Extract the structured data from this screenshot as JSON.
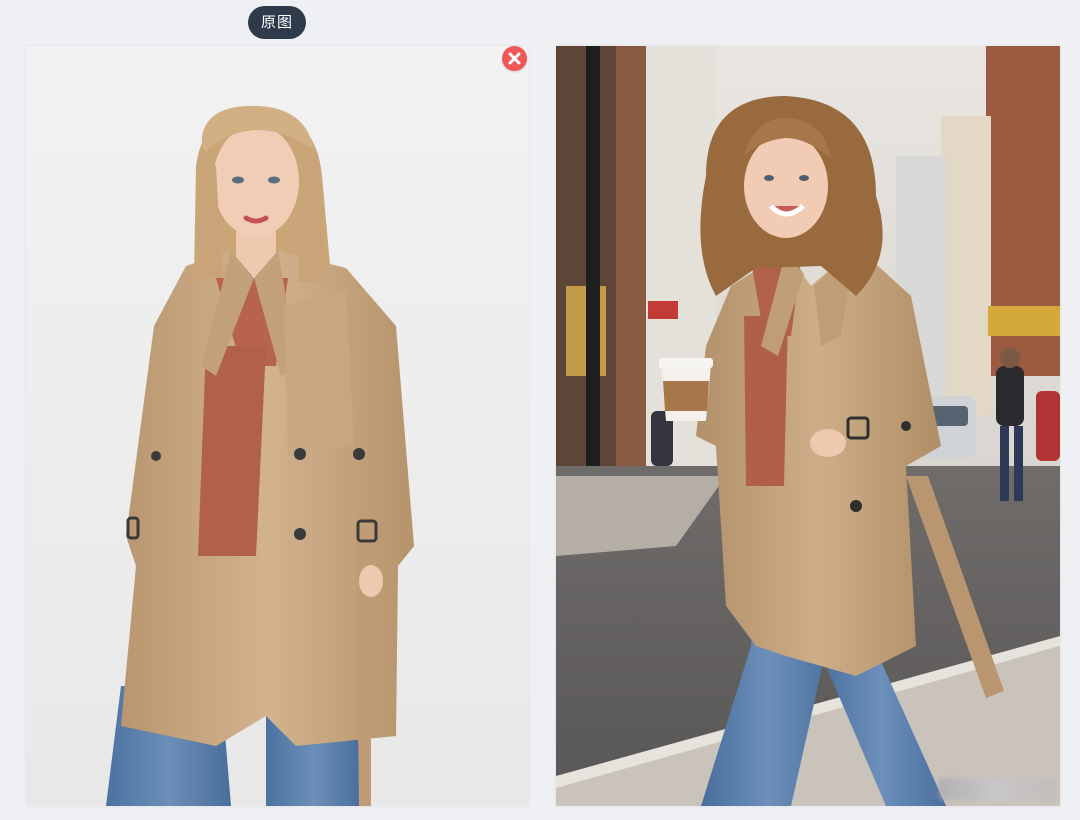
{
  "original_label": "原图",
  "panels": {
    "original": {
      "icon": "person-photo-icon"
    },
    "result": {
      "icon": "person-photo-icon"
    }
  },
  "remove_button": {
    "icon": "close-icon",
    "color": "#f25757"
  },
  "colors": {
    "background": "#eef0f4",
    "label_bg": "#2f3b4b",
    "coat": "#c9a983",
    "top": "#b8644c",
    "jeans": "#5a7ea6"
  }
}
